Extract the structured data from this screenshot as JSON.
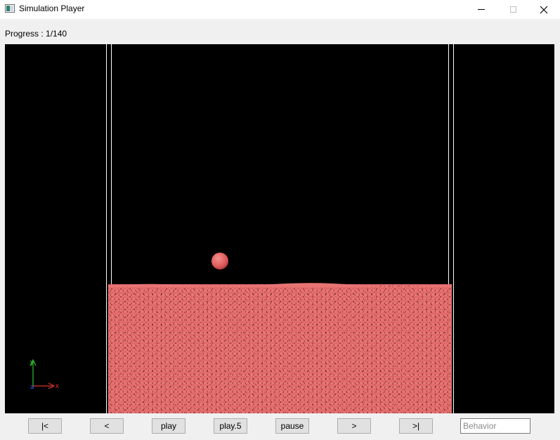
{
  "window": {
    "title": "Simulation Player",
    "icon": "app-window-icon",
    "controls": [
      "minimize-icon",
      "maximize-icon",
      "close-icon"
    ]
  },
  "progress": {
    "label": "Progress : 1/140",
    "current": 1,
    "total": 140
  },
  "viewport": {
    "background_color": "#000000",
    "particle_color": "#e06666",
    "wall_color": "#ffffff",
    "axis_labels": {
      "x": "x",
      "y": "y",
      "z": "z"
    },
    "axis_colors": {
      "x": "#e03030",
      "y": "#30c030",
      "z": "#3060e0"
    }
  },
  "controls": {
    "first_label": "|<",
    "prev_label": "<",
    "play_label": "play",
    "play5_label": "play.5",
    "pause_label": "pause",
    "next_label": ">",
    "last_label": ">|",
    "behavior_placeholder": "Behavior",
    "behavior_value": ""
  }
}
